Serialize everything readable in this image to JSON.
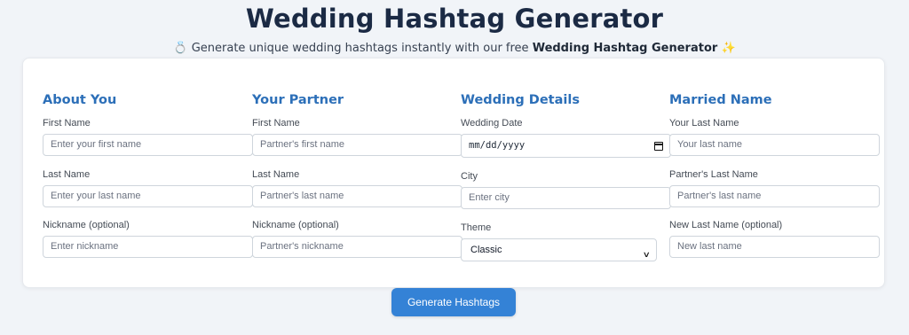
{
  "header": {
    "title": "Wedding Hashtag Generator",
    "subtitle_icon_left": "💍",
    "subtitle_text": "Generate unique wedding hashtags instantly with our free",
    "subtitle_strong": "Wedding Hashtag Generator",
    "subtitle_icon_right": "✨"
  },
  "columns": {
    "you": {
      "heading": "About You",
      "first_label": "First Name",
      "first_placeholder": "Enter your first name",
      "last_label": "Last Name",
      "last_placeholder": "Enter your last name",
      "nick_label": "Nickname (optional)",
      "nick_placeholder": "Enter nickname"
    },
    "partner": {
      "heading": "Your Partner",
      "first_label": "First Name",
      "first_placeholder": "Partner's first name",
      "last_label": "Last Name",
      "last_placeholder": "Partner's last name",
      "nick_label": "Nickname (optional)",
      "nick_placeholder": "Partner's nickname"
    },
    "details": {
      "heading": "Wedding Details",
      "date_label": "Wedding Date",
      "date_value": "mm/dd/yyyy",
      "city_label": "City",
      "city_placeholder": "Enter city",
      "theme_label": "Theme",
      "theme_value": "Classic"
    },
    "married": {
      "heading": "Married Name",
      "your_last_label": "Your Last Name",
      "your_last_placeholder": "Your last name",
      "partner_last_label": "Partner's Last Name",
      "partner_last_placeholder": "Partner's last name",
      "new_last_label": "New Last Name (optional)",
      "new_last_placeholder": "New last name"
    }
  },
  "actions": {
    "generate_label": "Generate Hashtags"
  },
  "colors": {
    "accent": "#3482d6",
    "heading": "#2c6fb8",
    "title": "#1b2a44"
  }
}
